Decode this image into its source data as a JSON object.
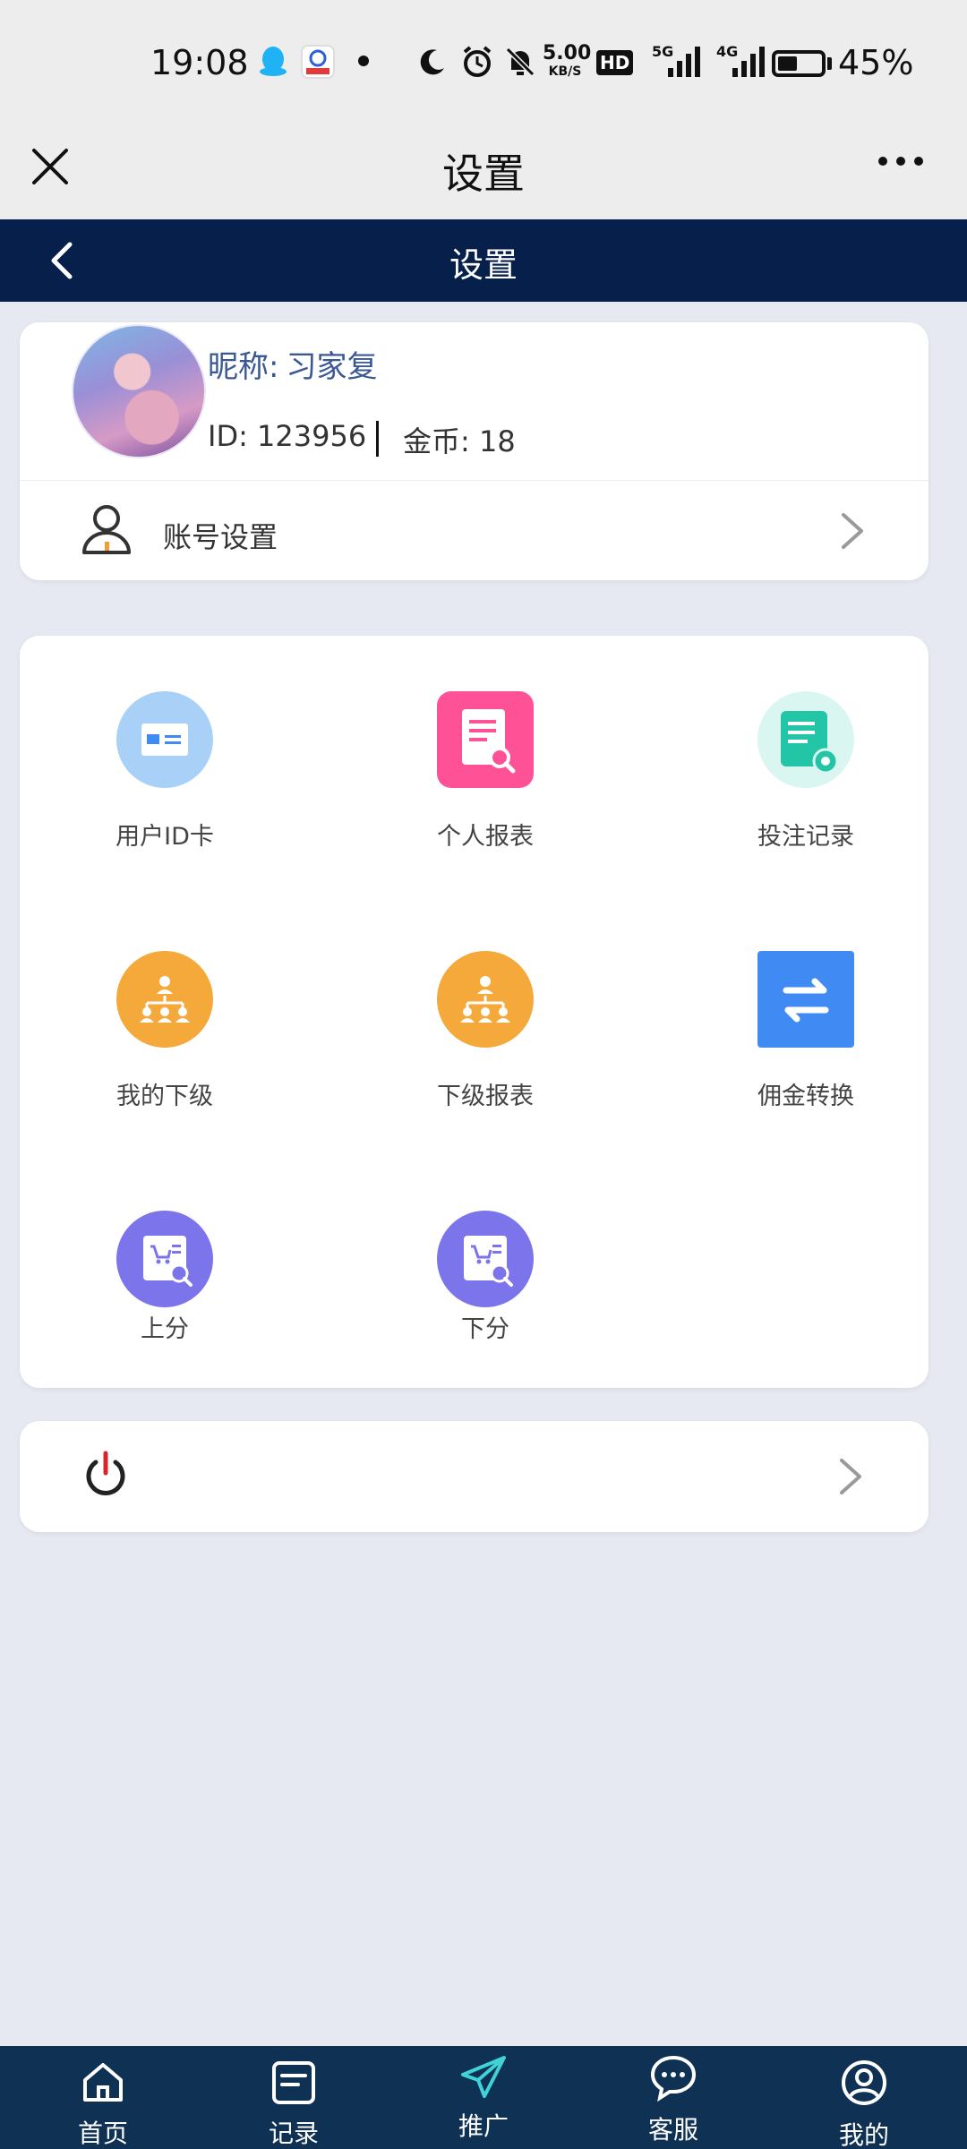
{
  "status_bar": {
    "time": "19:08",
    "network_speed_value": "5.00",
    "network_speed_unit": "KB/S",
    "hd_label": "HD",
    "signal_5g": "5G",
    "signal_4g": "4G",
    "battery_percent": "45%",
    "battery_level": 0.45
  },
  "web_title_bar": {
    "title": "设置"
  },
  "app_header": {
    "title": "设置"
  },
  "profile": {
    "nickname_label": "昵称:",
    "nickname": "习家复",
    "id_text": "ID: 123956",
    "coins_text": "金币: 18"
  },
  "account_settings": {
    "label": "账号设置"
  },
  "menu": {
    "items": [
      {
        "label": "用户ID卡"
      },
      {
        "label": "个人报表"
      },
      {
        "label": "投注记录"
      },
      {
        "label": "我的下级"
      },
      {
        "label": "下级报表"
      },
      {
        "label": "佣金转换"
      },
      {
        "label": "上分"
      },
      {
        "label": "下分"
      }
    ]
  },
  "bottom_nav": {
    "items": [
      {
        "label": "首页"
      },
      {
        "label": "记录"
      },
      {
        "label": "推广"
      },
      {
        "label": "客服"
      },
      {
        "label": "我的"
      }
    ]
  },
  "colors": {
    "header_bg": "#071f4b",
    "nav_bg": "#0e3154",
    "page_bg": "#e6e9f1",
    "nickname": "#3a5894",
    "orange_icon": "#f4a93a",
    "purple_icon": "#7b74ea",
    "pink_icon": "#ff5196",
    "blue_icon": "#3f8bf3"
  }
}
